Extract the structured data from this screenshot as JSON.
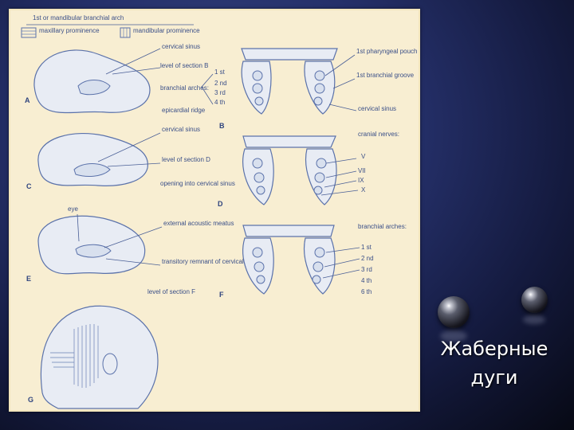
{
  "figure": {
    "header": "1st or mandibular branchial arch",
    "legend": [
      {
        "label": "maxillary prominence"
      },
      {
        "label": "mandibular prominence"
      }
    ],
    "panels": [
      "A",
      "B",
      "C",
      "D",
      "E",
      "F",
      "G"
    ],
    "labels_a": [
      "cervical sinus",
      "level of section B",
      "branchial arches:",
      "1 st",
      "2 nd",
      "3 rd",
      "4 th",
      "epicardial ridge"
    ],
    "labels_b_right": [
      "1st pharyngeal pouch",
      "1st branchial groove",
      "cervical sinus"
    ],
    "labels_c": [
      "cervical sinus",
      "level of section D",
      "opening into cervical sinus"
    ],
    "labels_d_right": [
      "cranial nerves:",
      "V",
      "VII",
      "IX",
      "X"
    ],
    "labels_e": [
      "eye",
      "external acoustic meatus",
      "transitory remnant of cervical sinus",
      "level of section F"
    ],
    "labels_f_right": [
      "branchial arches:",
      "1 st",
      "2 nd",
      "3 rd",
      "4 th",
      "6 th"
    ]
  },
  "slide": {
    "title_line1": "Жаберные",
    "title_line2": "дуги"
  }
}
